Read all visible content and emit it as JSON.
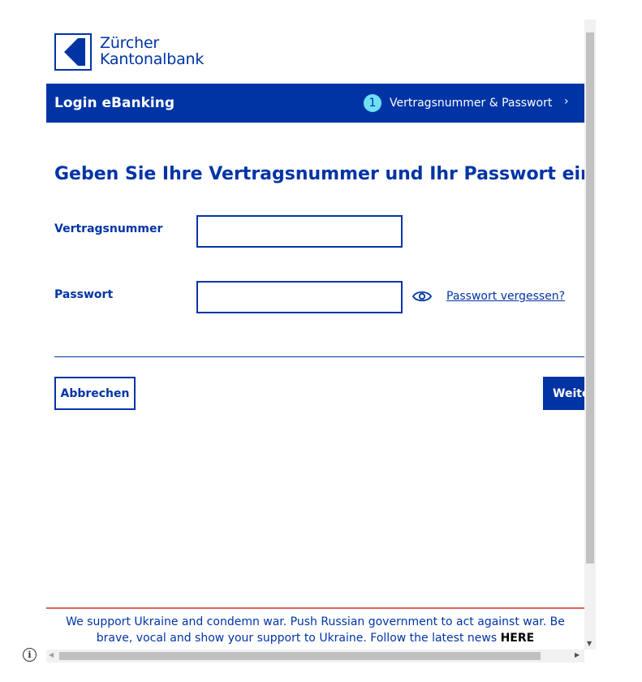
{
  "logo": {
    "line1": "Zürcher",
    "line2": "Kantonalbank"
  },
  "banner": {
    "title": "Login eBanking",
    "step_number": "1",
    "step_label": "Vertragsnummer & Passwort",
    "chevron": "›"
  },
  "form": {
    "heading": "Geben Sie Ihre Vertragsnummer und Ihr Passwort ein",
    "contract_label": "Vertragsnummer",
    "contract_value": "",
    "password_label": "Passwort",
    "password_value": "",
    "forgot_link": "Passwort vergessen?",
    "show_password_icon": "eye-icon"
  },
  "actions": {
    "cancel_label": "Abbrechen",
    "next_label": "Weiter"
  },
  "notice": {
    "text": "We support Ukraine and condemn war. Push Russian government to act against war. Be brave, vocal and show your support to Ukraine. Follow the latest news",
    "link": "HERE"
  },
  "colors": {
    "brand": "#0034a5",
    "step_badge": "#6ee0f5",
    "notice_border": "#e0605a"
  },
  "info_icon": "i"
}
